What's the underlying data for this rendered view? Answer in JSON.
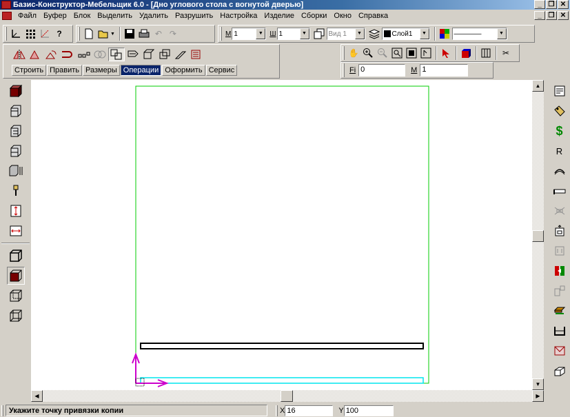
{
  "window": {
    "title": "Базис-Конструктор-Мебельщик 6.0 - [Дно углового стола с вогнутой дверью]",
    "controls": [
      "_",
      "❐",
      "✕"
    ]
  },
  "menu": {
    "items": [
      "Файл",
      "Буфер",
      "Блок",
      "Выделить",
      "Удалить",
      "Разрушить",
      "Настройка",
      "Изделие",
      "Сборки",
      "Окно",
      "Справка"
    ],
    "doc_controls": [
      "_",
      "❐",
      "✕"
    ]
  },
  "toolbar_top": {
    "material_label": "М",
    "material_value": "1",
    "width_label": "Ш",
    "width_value": "1",
    "view_value": "Вид 1",
    "layer_value": "Слой1",
    "line_style": "————"
  },
  "tabs": {
    "items": [
      "Строить",
      "Править",
      "Размеры",
      "Операции",
      "Оформить",
      "Сервис"
    ],
    "active": "Операции"
  },
  "props": {
    "fi_label": "Fi",
    "fi_value": "0",
    "m_label": "M",
    "m_value": "1"
  },
  "status": {
    "message": "Укажите точку привязки копии",
    "x_label": "X",
    "x_value": "16",
    "y_label": "Y",
    "y_value": "100"
  },
  "colors": {
    "frame_outline": "#00cc00",
    "panel_outline": "#000000",
    "selection_outline": "#00e5ee",
    "axis_color": "#cc00cc",
    "title_gradient_start": "#0a246a",
    "active_tab": "#0a246a"
  },
  "icons": {
    "left_toolbar": [
      "box-solid-icon",
      "panel-front-icon",
      "panel-side-icon",
      "panel-back-icon",
      "panel-group-icon",
      "fastener-icon",
      "vertical-size-icon",
      "horizontal-size-icon",
      "cube-outline-icon",
      "cube-filled-icon",
      "cube-wire-icon",
      "cube-hidden-icon"
    ],
    "right_toolbar": [
      "properties-icon",
      "materials-icon",
      "cost-icon",
      "radius-icon",
      "arc-icon",
      "handle-icon",
      "hinge-icon",
      "drawer-icon",
      "leg-icon",
      "split-icon",
      "insert-icon",
      "shelf-icon",
      "box-icon",
      "cut-icon",
      "3d-icon"
    ]
  }
}
